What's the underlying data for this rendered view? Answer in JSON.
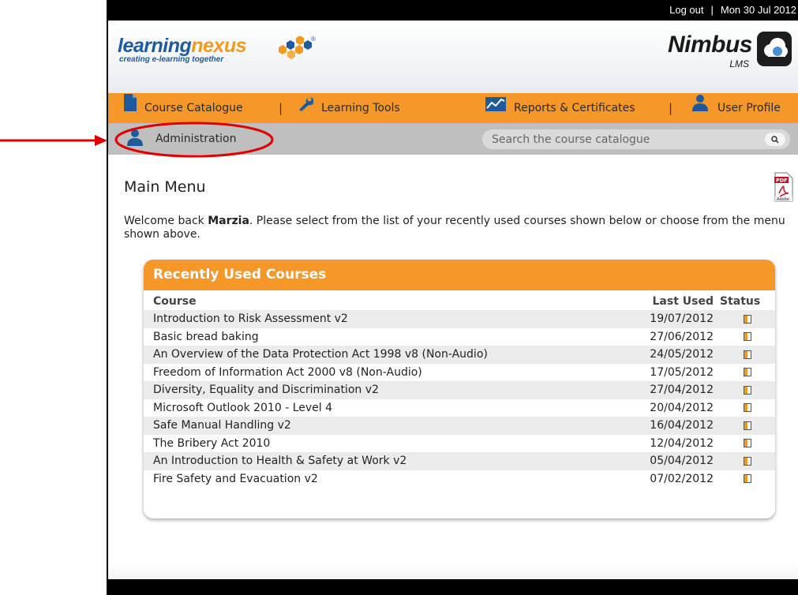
{
  "topbar": {
    "logout": "Log out",
    "separator": "|",
    "date": "Mon 30 Jul 2012"
  },
  "logo": {
    "name_part1": "learning",
    "name_part2": "nexus",
    "registered": "®",
    "tagline": "creating e-learning together"
  },
  "brand": {
    "name": "Nimbus",
    "sub": "LMS"
  },
  "nav": {
    "items": [
      {
        "label": "Course Catalogue",
        "icon": "document-icon"
      },
      {
        "label": "Learning Tools",
        "icon": "wrench-icon"
      },
      {
        "label": "Reports & Certificates",
        "icon": "chart-icon"
      },
      {
        "label": "User Profile",
        "icon": "user-icon"
      }
    ],
    "separator": "|"
  },
  "subnav": {
    "admin_label": "Administration",
    "search_placeholder": "Search the course catalogue"
  },
  "main": {
    "title": "Main Menu",
    "welcome_prefix": "Welcome back ",
    "user_name": "Marzia",
    "welcome_suffix": ". Please select from the list of your recently used courses shown below or choose from the menu shown above.",
    "pdf_label": "PDF",
    "pdf_brand": "Adobe"
  },
  "recent": {
    "heading": "Recently Used Courses",
    "columns": {
      "course": "Course",
      "last_used": "Last Used",
      "status": "Status"
    },
    "rows": [
      {
        "course": "Introduction to Risk Assessment v2",
        "last_used": "19/07/2012"
      },
      {
        "course": "Basic bread baking",
        "last_used": "27/06/2012"
      },
      {
        "course": "An Overview of the Data Protection Act 1998 v8 (Non-Audio)",
        "last_used": "24/05/2012"
      },
      {
        "course": "Freedom of Information Act 2000 v8 (Non-Audio)",
        "last_used": "17/05/2012"
      },
      {
        "course": "Diversity, Equality and Discrimination v2",
        "last_used": "27/04/2012"
      },
      {
        "course": "Microsoft Outlook 2010 - Level 4",
        "last_used": "20/04/2012"
      },
      {
        "course": "Safe Manual Handling v2",
        "last_used": "16/04/2012"
      },
      {
        "course": "The Bribery Act 2010",
        "last_used": "12/04/2012"
      },
      {
        "course": "An Introduction to Health & Safety at Work v2",
        "last_used": "05/04/2012"
      },
      {
        "course": "Fire Safety and Evacuation v2",
        "last_used": "07/02/2012"
      }
    ]
  },
  "colors": {
    "accent_orange": "#f6972a",
    "subnav_grey": "#bfbfbf",
    "logo_blue": "#1e5a9c",
    "annotation_red": "#e00000"
  }
}
